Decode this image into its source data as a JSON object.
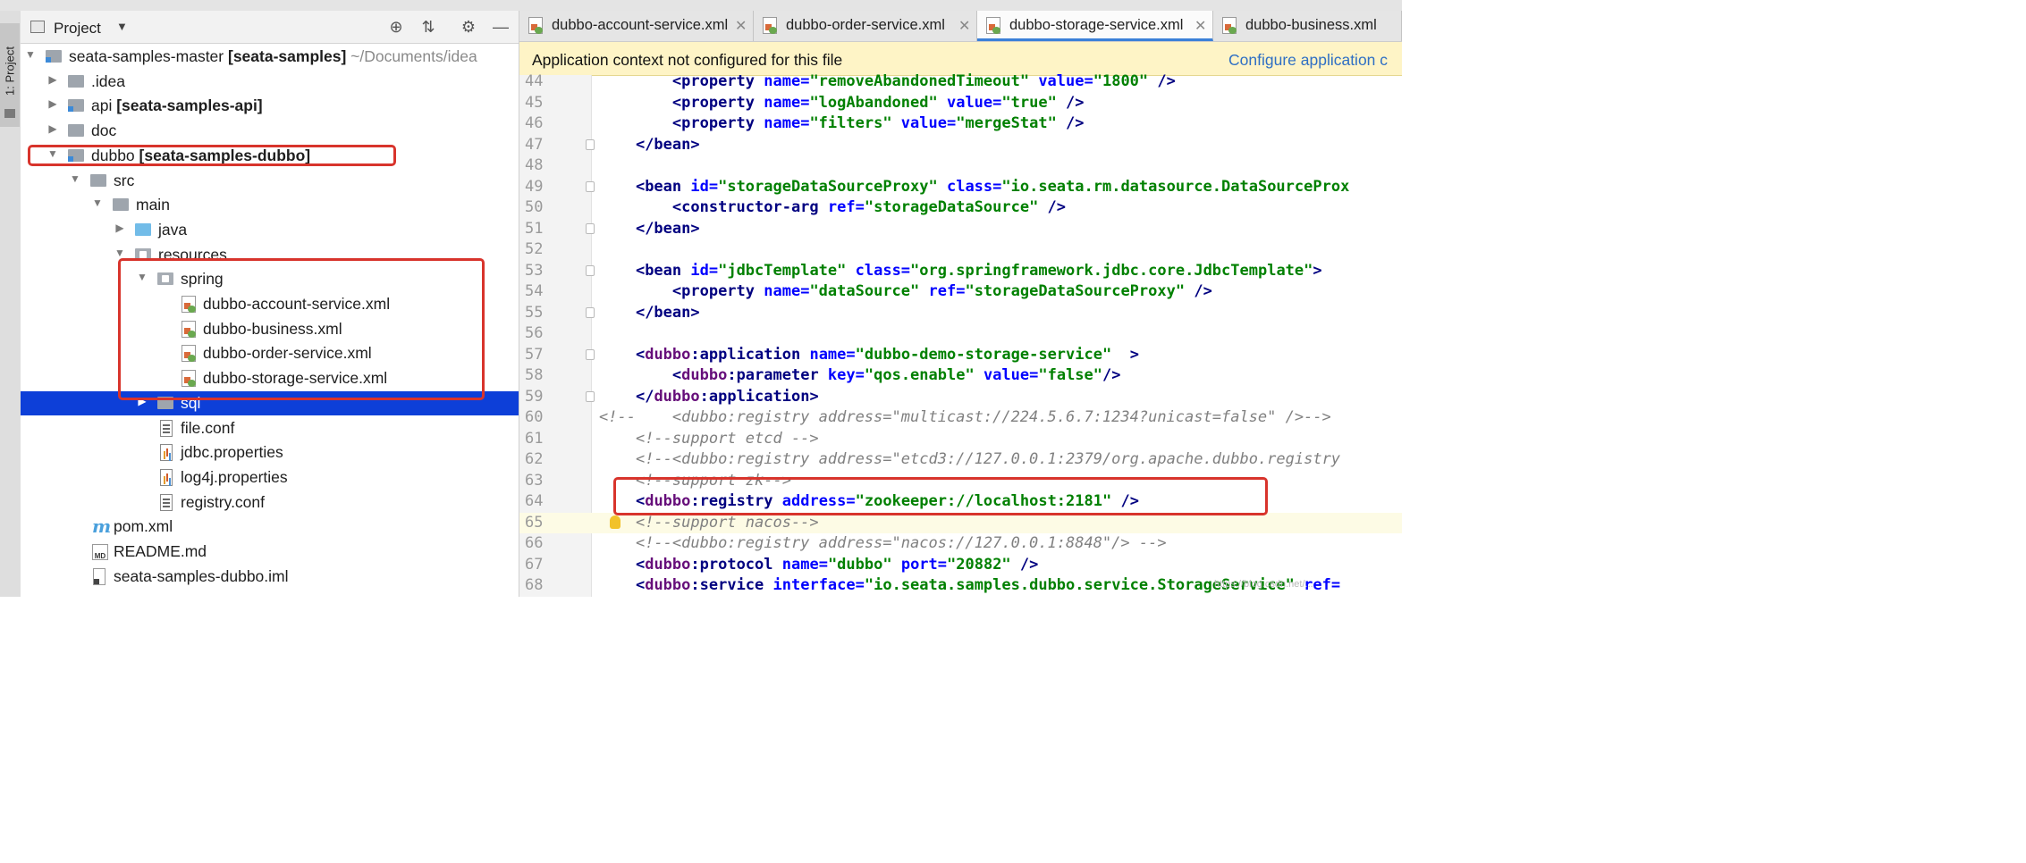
{
  "tool_window": {
    "side_tab": "1: Project",
    "title": "Project",
    "icons": [
      "crosshair-icon",
      "collapse-all-icon",
      "gear-icon",
      "minimize-icon"
    ]
  },
  "tree": [
    {
      "label": "seata-samples-master",
      "module": "[seata-samples]",
      "path": "~/Documents/idea"
    },
    {
      "label": ".idea"
    },
    {
      "label": "api",
      "module": "[seata-samples-api]"
    },
    {
      "label": "doc"
    },
    {
      "label": "dubbo",
      "module": "[seata-samples-dubbo]"
    },
    {
      "label": "src"
    },
    {
      "label": "main"
    },
    {
      "label": "java"
    },
    {
      "label": "resources"
    },
    {
      "label": "spring"
    },
    {
      "label": "dubbo-account-service.xml"
    },
    {
      "label": "dubbo-business.xml"
    },
    {
      "label": "dubbo-order-service.xml"
    },
    {
      "label": "dubbo-storage-service.xml"
    },
    {
      "label": "sql"
    },
    {
      "label": "file.conf"
    },
    {
      "label": "jdbc.properties"
    },
    {
      "label": "log4j.properties"
    },
    {
      "label": "registry.conf"
    },
    {
      "label": "pom.xml"
    },
    {
      "label": "README.md"
    },
    {
      "label": "seata-samples-dubbo.iml"
    }
  ],
  "tabs": [
    {
      "label": "dubbo-account-service.xml"
    },
    {
      "label": "dubbo-order-service.xml"
    },
    {
      "label": "dubbo-storage-service.xml"
    },
    {
      "label": "dubbo-business.xml"
    }
  ],
  "banner": {
    "message": "Application context not configured for this file",
    "link": "Configure application c"
  },
  "code_lines": [
    {
      "n": "44",
      "segs": [
        [
          "pl",
          "        "
        ],
        [
          "tag",
          "<property "
        ],
        [
          "attr",
          "name="
        ],
        [
          "val",
          "\"removeAbandonedTimeout\" "
        ],
        [
          "attr",
          "value="
        ],
        [
          "val",
          "\"1800\" "
        ],
        [
          "tag",
          "/>"
        ]
      ]
    },
    {
      "n": "45",
      "segs": [
        [
          "pl",
          "        "
        ],
        [
          "tag",
          "<property "
        ],
        [
          "attr",
          "name="
        ],
        [
          "val",
          "\"logAbandoned\" "
        ],
        [
          "attr",
          "value="
        ],
        [
          "val",
          "\"true\" "
        ],
        [
          "tag",
          "/>"
        ]
      ]
    },
    {
      "n": "46",
      "segs": [
        [
          "pl",
          "        "
        ],
        [
          "tag",
          "<property "
        ],
        [
          "attr",
          "name="
        ],
        [
          "val",
          "\"filters\" "
        ],
        [
          "attr",
          "value="
        ],
        [
          "val",
          "\"mergeStat\" "
        ],
        [
          "tag",
          "/>"
        ]
      ]
    },
    {
      "n": "47",
      "segs": [
        [
          "pl",
          "    "
        ],
        [
          "tag",
          "</bean>"
        ]
      ]
    },
    {
      "n": "48",
      "segs": []
    },
    {
      "n": "49",
      "segs": [
        [
          "pl",
          "    "
        ],
        [
          "tag",
          "<bean "
        ],
        [
          "attr",
          "id="
        ],
        [
          "val",
          "\"storageDataSourceProxy\" "
        ],
        [
          "attr",
          "class="
        ],
        [
          "val",
          "\"io.seata.rm.datasource.DataSourceProx"
        ]
      ]
    },
    {
      "n": "50",
      "segs": [
        [
          "pl",
          "        "
        ],
        [
          "tag",
          "<constructor-arg "
        ],
        [
          "attr",
          "ref="
        ],
        [
          "val",
          "\"storageDataSource\" "
        ],
        [
          "tag",
          "/>"
        ]
      ]
    },
    {
      "n": "51",
      "segs": [
        [
          "pl",
          "    "
        ],
        [
          "tag",
          "</bean>"
        ]
      ]
    },
    {
      "n": "52",
      "segs": []
    },
    {
      "n": "53",
      "segs": [
        [
          "pl",
          "    "
        ],
        [
          "tag",
          "<bean "
        ],
        [
          "attr",
          "id="
        ],
        [
          "val",
          "\"jdbcTemplate\" "
        ],
        [
          "attr",
          "class="
        ],
        [
          "val",
          "\"org.springframework.jdbc.core.JdbcTemplate\""
        ],
        [
          "tag",
          ">"
        ]
      ]
    },
    {
      "n": "54",
      "segs": [
        [
          "pl",
          "        "
        ],
        [
          "tag",
          "<property "
        ],
        [
          "attr",
          "name="
        ],
        [
          "val",
          "\"dataSource\" "
        ],
        [
          "attr",
          "ref="
        ],
        [
          "val",
          "\"storageDataSourceProxy\" "
        ],
        [
          "tag",
          "/>"
        ]
      ]
    },
    {
      "n": "55",
      "segs": [
        [
          "pl",
          "    "
        ],
        [
          "tag",
          "</bean>"
        ]
      ]
    },
    {
      "n": "56",
      "segs": []
    },
    {
      "n": "57",
      "segs": [
        [
          "pl",
          "    "
        ],
        [
          "tag",
          "<"
        ],
        [
          "ns",
          "dubbo"
        ],
        [
          "tag",
          ":application "
        ],
        [
          "attr",
          "name="
        ],
        [
          "val",
          "\"dubbo-demo-storage-service\""
        ],
        [
          "pl",
          "  "
        ],
        [
          "tag",
          ">"
        ]
      ]
    },
    {
      "n": "58",
      "segs": [
        [
          "pl",
          "        "
        ],
        [
          "tag",
          "<"
        ],
        [
          "ns",
          "dubbo"
        ],
        [
          "tag",
          ":parameter "
        ],
        [
          "attr",
          "key="
        ],
        [
          "val",
          "\"qos.enable\" "
        ],
        [
          "attr",
          "value="
        ],
        [
          "val",
          "\"false\""
        ],
        [
          "tag",
          "/>"
        ]
      ]
    },
    {
      "n": "59",
      "segs": [
        [
          "pl",
          "    "
        ],
        [
          "tag",
          "</"
        ],
        [
          "ns",
          "dubbo"
        ],
        [
          "tag",
          ":application>"
        ]
      ]
    },
    {
      "n": "60",
      "segs": [
        [
          "cmt",
          "<!--    <dubbo:registry address=\"multicast://224.5.6.7:1234?unicast=false\" />-->"
        ]
      ]
    },
    {
      "n": "61",
      "segs": [
        [
          "pl",
          "    "
        ],
        [
          "cmt",
          "<!--support etcd -->"
        ]
      ]
    },
    {
      "n": "62",
      "segs": [
        [
          "pl",
          "    "
        ],
        [
          "cmt",
          "<!--<dubbo:registry address=\"etcd3://127.0.0.1:2379/org.apache.dubbo.registry"
        ]
      ]
    },
    {
      "n": "63",
      "segs": [
        [
          "pl",
          "    "
        ],
        [
          "cmt",
          "<!--support zk-->"
        ]
      ]
    },
    {
      "n": "64",
      "segs": [
        [
          "pl",
          "    "
        ],
        [
          "tag",
          "<"
        ],
        [
          "ns",
          "dubbo"
        ],
        [
          "tag",
          ":registry "
        ],
        [
          "attr",
          "address="
        ],
        [
          "val",
          "\"zookeeper://localhost:2181\" "
        ],
        [
          "tag",
          "/>"
        ]
      ]
    },
    {
      "n": "65",
      "segs": [
        [
          "pl",
          "    "
        ],
        [
          "cmt",
          "<!--support nacos-->"
        ]
      ]
    },
    {
      "n": "66",
      "segs": [
        [
          "pl",
          "    "
        ],
        [
          "cmt",
          "<!--<dubbo:registry address=\"nacos://127.0.0.1:8848\"/> -->"
        ]
      ]
    },
    {
      "n": "67",
      "segs": [
        [
          "pl",
          "    "
        ],
        [
          "tag",
          "<"
        ],
        [
          "ns",
          "dubbo"
        ],
        [
          "tag",
          ":protocol "
        ],
        [
          "attr",
          "name="
        ],
        [
          "val",
          "\"dubbo\" "
        ],
        [
          "attr",
          "port="
        ],
        [
          "val",
          "\"20882\" "
        ],
        [
          "tag",
          "/>"
        ]
      ]
    },
    {
      "n": "68",
      "segs": [
        [
          "pl",
          "    "
        ],
        [
          "tag",
          "<"
        ],
        [
          "ns",
          "dubbo"
        ],
        [
          "tag",
          ":service "
        ],
        [
          "attr",
          "interface="
        ],
        [
          "val",
          "\"io.seata.samples.dubbo.service.StorageService\" "
        ],
        [
          "attr",
          "ref="
        ]
      ]
    }
  ],
  "watermark": "https://blog.csdn.net/..."
}
